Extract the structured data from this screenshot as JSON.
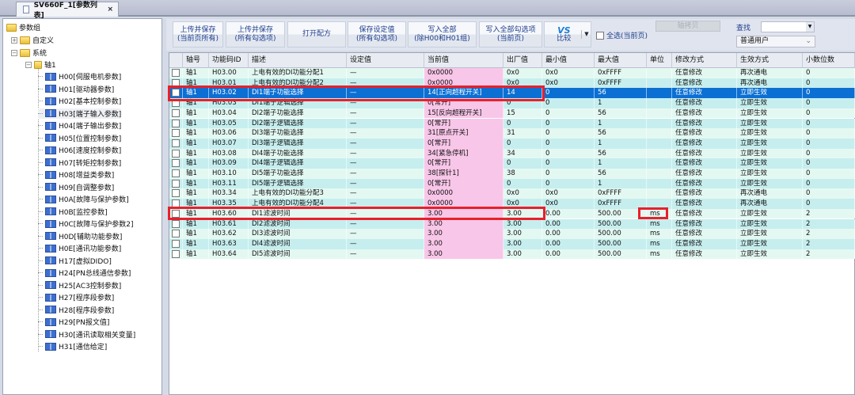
{
  "tab": {
    "title": "SV660F_1[参数列表]",
    "close": "×"
  },
  "tree": {
    "root": "参数组",
    "custom": "自定义",
    "system": "系统",
    "axis": "轴1",
    "groups": [
      "H00[伺服电机参数]",
      "H01[驱动器参数]",
      "H02[基本控制参数]",
      "H03[端子输入参数]",
      "H04[端子输出参数]",
      "H05[位置控制参数]",
      "H06[速度控制参数]",
      "H07[转矩控制参数]",
      "H08[增益类参数]",
      "H09[自调整参数]",
      "H0A[故障与保护参数]",
      "H0B[监控参数]",
      "H0C[故障与保护参数2]",
      "H0D[辅助功能参数]",
      "H0E[通讯功能参数]",
      "H17[虚拟DIDO]",
      "H24[PN总线通信参数]",
      "H25[AC3控制参数]",
      "H27[程序段参数]",
      "H28[程序段参数]",
      "H29[PN报文值]",
      "H30[通讯读取相关变量]",
      "H31[通信给定]"
    ]
  },
  "toolbar": {
    "upload_page": [
      "上传并保存",
      "(当前页所有)"
    ],
    "upload_checked": [
      "上传并保存",
      "(所有勾选项)"
    ],
    "open_recipe": "打开配方",
    "save_setting": [
      "保存设定值",
      "(所有勾选项)"
    ],
    "write_all": [
      "写入全部",
      "(除H00和H01组)"
    ],
    "write_checked": [
      "写入全部勾选项",
      "(当前页)"
    ],
    "compare_logo": "VS",
    "compare": "比较",
    "select_all": "全选(当前页)",
    "axis_copy": "轴拷贝",
    "search_label": "查找",
    "search_value": "",
    "user_level": "普通用户"
  },
  "table": {
    "headers": [
      "",
      "轴号",
      "功能码ID",
      "描述",
      "设定值",
      "当前值",
      "出厂值",
      "最小值",
      "最大值",
      "单位",
      "修改方式",
      "生效方式",
      "小数位数"
    ],
    "rows": [
      [
        "轴1",
        "H03.00",
        "上电有效的DI功能分配1",
        "—",
        "0x0000",
        "0x0",
        "0x0",
        "0xFFFF",
        "",
        "任意修改",
        "再次通电",
        "0"
      ],
      [
        "轴1",
        "H03.01",
        "上电有效的DI功能分配2",
        "—",
        "0x0000",
        "0x0",
        "0x0",
        "0xFFFF",
        "",
        "任意修改",
        "再次通电",
        "0"
      ],
      [
        "轴1",
        "H03.02",
        "DI1端子功能选择",
        "—",
        "14[正向超程开关]",
        "14",
        "0",
        "56",
        "",
        "任意修改",
        "立即生效",
        "0"
      ],
      [
        "轴1",
        "H03.03",
        "DI1端子逻辑选择",
        "—",
        "0[常开]",
        "0",
        "0",
        "1",
        "",
        "任意修改",
        "立即生效",
        "0"
      ],
      [
        "轴1",
        "H03.04",
        "DI2端子功能选择",
        "—",
        "15[反向超程开关]",
        "15",
        "0",
        "56",
        "",
        "任意修改",
        "立即生效",
        "0"
      ],
      [
        "轴1",
        "H03.05",
        "DI2端子逻辑选择",
        "—",
        "0[常开]",
        "0",
        "0",
        "1",
        "",
        "任意修改",
        "立即生效",
        "0"
      ],
      [
        "轴1",
        "H03.06",
        "DI3端子功能选择",
        "—",
        "31[原点开关]",
        "31",
        "0",
        "56",
        "",
        "任意修改",
        "立即生效",
        "0"
      ],
      [
        "轴1",
        "H03.07",
        "DI3端子逻辑选择",
        "—",
        "0[常开]",
        "0",
        "0",
        "1",
        "",
        "任意修改",
        "立即生效",
        "0"
      ],
      [
        "轴1",
        "H03.08",
        "DI4端子功能选择",
        "—",
        "34[紧急停机]",
        "34",
        "0",
        "56",
        "",
        "任意修改",
        "立即生效",
        "0"
      ],
      [
        "轴1",
        "H03.09",
        "DI4端子逻辑选择",
        "—",
        "0[常开]",
        "0",
        "0",
        "1",
        "",
        "任意修改",
        "立即生效",
        "0"
      ],
      [
        "轴1",
        "H03.10",
        "DI5端子功能选择",
        "—",
        "38[探针1]",
        "38",
        "0",
        "56",
        "",
        "任意修改",
        "立即生效",
        "0"
      ],
      [
        "轴1",
        "H03.11",
        "DI5端子逻辑选择",
        "—",
        "0[常开]",
        "0",
        "0",
        "1",
        "",
        "任意修改",
        "立即生效",
        "0"
      ],
      [
        "轴1",
        "H03.34",
        "上电有效的DI功能分配3",
        "—",
        "0x0000",
        "0x0",
        "0x0",
        "0xFFFF",
        "",
        "任意修改",
        "再次通电",
        "0"
      ],
      [
        "轴1",
        "H03.35",
        "上电有效的DI功能分配4",
        "—",
        "0x0000",
        "0x0",
        "0x0",
        "0xFFFF",
        "",
        "任意修改",
        "再次通电",
        "0"
      ],
      [
        "轴1",
        "H03.60",
        "DI1滤波时间",
        "—",
        "3.00",
        "3.00",
        "0.00",
        "500.00",
        "ms",
        "任意修改",
        "立即生效",
        "2"
      ],
      [
        "轴1",
        "H03.61",
        "DI2滤波时间",
        "—",
        "3.00",
        "3.00",
        "0.00",
        "500.00",
        "ms",
        "任意修改",
        "立即生效",
        "2"
      ],
      [
        "轴1",
        "H03.62",
        "DI3滤波时间",
        "—",
        "3.00",
        "3.00",
        "0.00",
        "500.00",
        "ms",
        "任意修改",
        "立即生效",
        "2"
      ],
      [
        "轴1",
        "H03.63",
        "DI4滤波时间",
        "—",
        "3.00",
        "3.00",
        "0.00",
        "500.00",
        "ms",
        "任意修改",
        "立即生效",
        "2"
      ],
      [
        "轴1",
        "H03.64",
        "DI5滤波时间",
        "—",
        "3.00",
        "3.00",
        "0.00",
        "500.00",
        "ms",
        "任意修改",
        "立即生效",
        "2"
      ]
    ],
    "selected_row": 2
  },
  "colors": {
    "row_light": "#e4f8f2",
    "row_dark": "#c6eeee",
    "current_value": "#f8c6e8",
    "selected": "#0b6fd3",
    "highlight": "#e8202a"
  }
}
